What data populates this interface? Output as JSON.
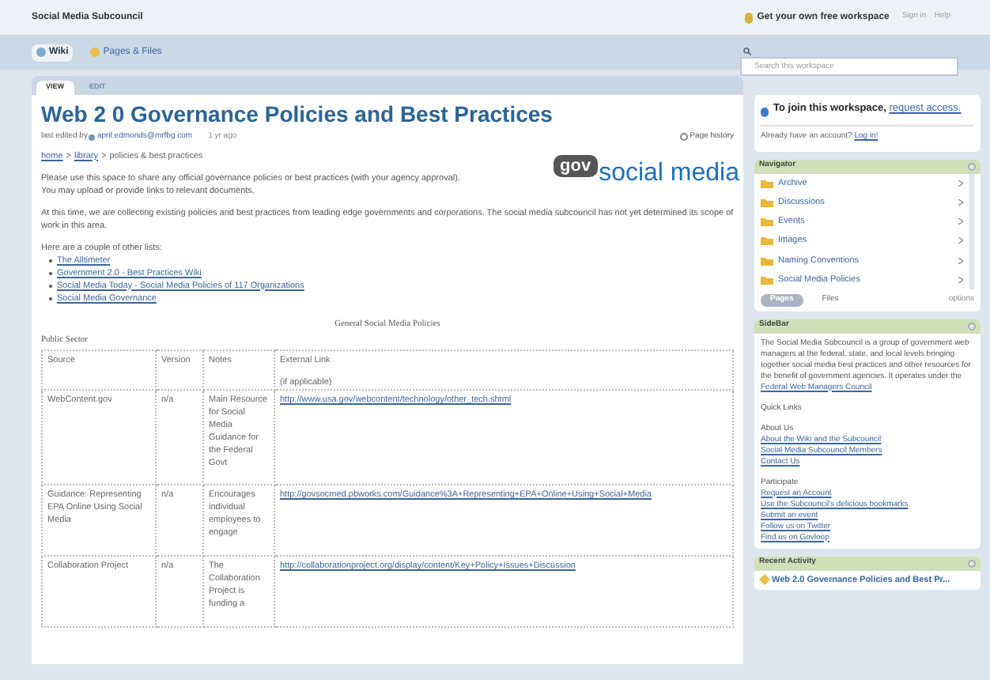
{
  "top_bar": {
    "workspace": "Social Media Subcouncil",
    "promo": "Get your own free workspace",
    "links": [
      "Sign in",
      "Help"
    ]
  },
  "nav_tabs": [
    {
      "label": "Wiki",
      "selected": true
    },
    {
      "label": "Pages & Files",
      "selected": false
    }
  ],
  "search": {
    "placeholder": "Search this workspace"
  },
  "view_tabs": [
    {
      "label": "VIEW",
      "selected": true
    },
    {
      "label": "EDIT",
      "selected": false
    }
  ],
  "page": {
    "title": "Web 2 0 Governance Policies and Best Practices",
    "edited_prefix": "last edited by",
    "editor": "april.edmonds@mrfbg.com",
    "edited_time": "1 yr ago",
    "history": "Page history",
    "breadcrumb": [
      {
        "kind": "link",
        "text": "home"
      },
      {
        "kind": "sep",
        "text": ">"
      },
      {
        "kind": "link",
        "text": "library"
      },
      {
        "kind": "sep",
        "text": ">"
      },
      {
        "kind": "text",
        "text": "policies & best practices"
      }
    ],
    "logo": {
      "badge": "gov",
      "text": "social media"
    },
    "paragraphs": [
      "Please use this space to share any official governance policies or best practices (with your agency approval).",
      "You may upload or provide links to relevant documents.",
      "At this time, we are collecting existing policies and best practices from leading edge governments and corporations.  The social media subcouncil has not yet determined its scope of work in this area."
    ],
    "list_intro": "Here are a couple of other lists:",
    "links": [
      "The Alltimeter",
      "Government 2.0 - Best Practices Wiki",
      "Social Media Today - Social Media Policies of 117 Organizations",
      "Social Media Governance"
    ],
    "table": {
      "caption": "General Social Media Policies",
      "section": "Public Sector",
      "columns": [
        {
          "label": "Source"
        },
        {
          "label": "Version"
        },
        {
          "label": "Notes"
        },
        {
          "label": "External Link",
          "note": "(if applicable)"
        }
      ],
      "rows": [
        {
          "source": "WebContent.gov",
          "version": "n/a",
          "notes": "Main Resource for Social Media Guidance for the Federal Govt",
          "link": "http://www.usa.gov/webcontent/technology/other_tech.shtml"
        },
        {
          "source": "Guidance: Representing EPA Online Using Social Media",
          "version": "n/a",
          "notes": "Encourages individual employees to engage",
          "link": "http://govsocmed.pbworks.com/Guidance%3A+Representing+EPA+Online+Using+Social+Media"
        },
        {
          "source": "Collaboration Project",
          "version": "n/a",
          "notes": "The Collaboration Project is funding a",
          "link": "http://collaborationproject.org/display/content/Key+Policy+Issues+Discussion"
        }
      ]
    }
  },
  "sidebar": {
    "join": {
      "text": "To join this workspace,",
      "link": "request access."
    },
    "login": {
      "text": "Already have an account?",
      "link": "Log in!"
    },
    "navigator": {
      "title": "Navigator",
      "items": [
        "Archive",
        "Discussions",
        "Events",
        "Images",
        "Naming Conventions",
        "Social Media Policies"
      ],
      "tabs": [
        {
          "label": "Pages",
          "selected": true
        },
        {
          "label": "Files",
          "selected": false
        }
      ],
      "options": "options"
    },
    "panel": {
      "title": "SideBar",
      "blurb": "The Social Media Subcouncil is a group of government web managers at the federal, state, and local levels bringing together social media best practices and other resources for the benefit of government agencies.  It operates under the",
      "blurb_link": "Federal Web Managers Council",
      "sections": [
        {
          "heading": "Quick Links"
        },
        {
          "heading": "About Us",
          "links": [
            "About the Wiki and the Subcouncil",
            "Social Media Subcouncil Members",
            "Contact Us"
          ]
        },
        {
          "heading": "Participate",
          "links": [
            "Request an Account",
            "Use the Subcouncil's delicious bookmarks",
            "Submit an event",
            "Follow us on Twitter",
            "Find us on Govloop"
          ]
        }
      ]
    },
    "recent": {
      "title": "Recent Activity",
      "items": [
        "Web 2.0 Governance Policies and Best Pr..."
      ]
    }
  }
}
